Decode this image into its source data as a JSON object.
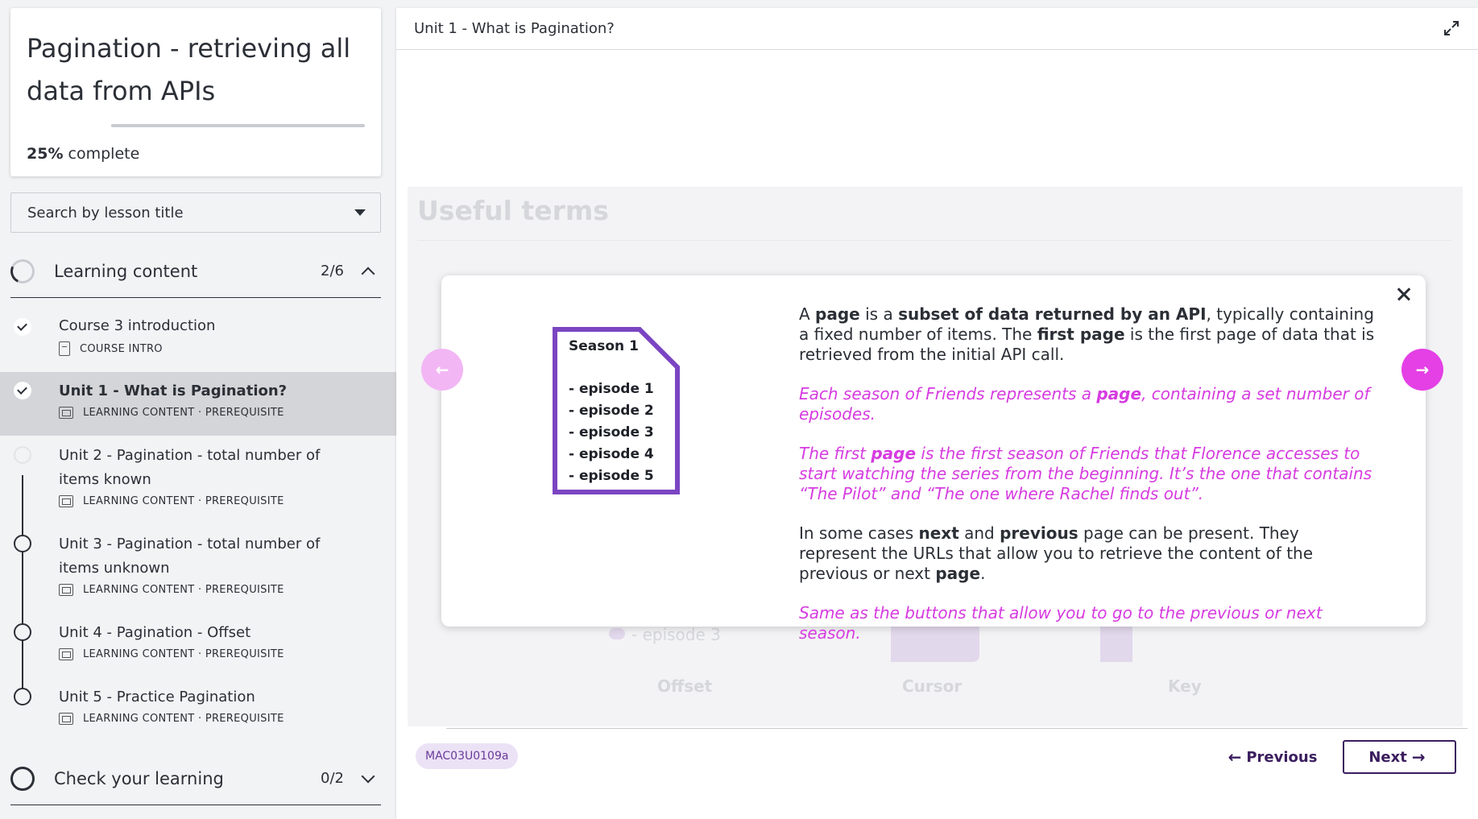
{
  "sidebar": {
    "course_title": "Pagination - retrieving all data from APIs",
    "progress_percent": 25,
    "progress_value": "25%",
    "progress_suffix": "complete",
    "search_placeholder": "Search by lesson title",
    "sections": [
      {
        "label": "Learning content",
        "count": "2/6",
        "expanded": true
      },
      {
        "label": "Check your learning",
        "count": "0/2",
        "expanded": false
      }
    ],
    "lessons": [
      {
        "title": "Course 3 introduction",
        "meta": "COURSE INTRO",
        "status": "done"
      },
      {
        "title": "Unit 1 - What is Pagination?",
        "meta": "LEARNING CONTENT · PREREQUISITE",
        "status": "done",
        "active": true
      },
      {
        "title": "Unit 2 - Pagination - total number of items known",
        "meta": "LEARNING CONTENT · PREREQUISITE",
        "status": "todo"
      },
      {
        "title": "Unit 3 - Pagination - total number of items unknown",
        "meta": "LEARNING CONTENT · PREREQUISITE",
        "status": "todo"
      },
      {
        "title": "Unit 4 - Pagination - Offset",
        "meta": "LEARNING CONTENT · PREREQUISITE",
        "status": "todo"
      },
      {
        "title": "Unit 5 - Practice Pagination",
        "meta": "LEARNING CONTENT · PREREQUISITE",
        "status": "todo"
      }
    ]
  },
  "main": {
    "header_title": "Unit 1 - What is Pagination?",
    "background": {
      "title": "Useful terms",
      "episode_label": "- episode 3",
      "labels": [
        "Offset",
        "Cursor",
        "Key"
      ]
    },
    "code_badge": "MAC03U0109a",
    "previous_label": "Previous",
    "next_label": "Next"
  },
  "modal": {
    "illustration": {
      "heading": "Season 1",
      "items": [
        "- episode 1",
        "- episode 2",
        "- episode 3",
        "- episode 4",
        "- episode 5"
      ]
    },
    "p1": {
      "t1": "A ",
      "b1": "page",
      "t2": " is a ",
      "b2": "subset of data returned by an API",
      "t3": ", typically containing a fixed number of items. The ",
      "b3": "first page",
      "t4": " is the first page of data that is retrieved from the initial API call."
    },
    "p2": {
      "t1": "Each season of Friends represents a ",
      "b1": "page",
      "t2": ", containing a set number of episodes."
    },
    "p3": {
      "t1": "The first ",
      "b1": "page",
      "t2": " is the first season of Friends that Florence accesses to start watching the series from the beginning. It’s the one that contains “The Pilot” and “The one where Rachel finds out”."
    },
    "p4": {
      "t1": "In some cases ",
      "b1": "next",
      "t2": " and ",
      "b2": "previous",
      "t3": " page can be present. They represent the URLs that allow you to retrieve the content of the previous or next ",
      "b3": "page",
      "t4": "."
    },
    "p5": "Same as the buttons that allow you to go to the previous or next season.",
    "colors": {
      "accent_pink": "#d63be0",
      "illustration_border": "#7b45c2",
      "brand_dark": "#3b1d5e"
    }
  }
}
